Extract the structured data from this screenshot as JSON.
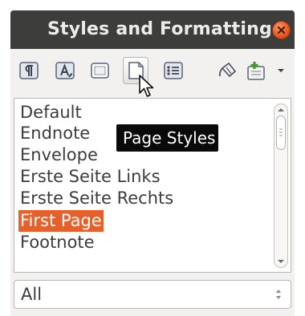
{
  "window": {
    "title": "Styles and Formatting",
    "close_icon": "close-icon"
  },
  "toolbar": {
    "buttons": [
      {
        "name": "paragraph-styles-icon"
      },
      {
        "name": "character-styles-icon"
      },
      {
        "name": "frame-styles-icon"
      },
      {
        "name": "page-styles-icon",
        "active": true
      },
      {
        "name": "list-styles-icon"
      },
      {
        "name": "fill-format-mode-icon"
      },
      {
        "name": "new-style-from-selection-icon"
      },
      {
        "name": "dropdown-arrow-icon"
      }
    ]
  },
  "tooltip": {
    "text": "Page Styles"
  },
  "style_list": {
    "items": [
      {
        "label": "Default"
      },
      {
        "label": "Endnote"
      },
      {
        "label": "Envelope"
      },
      {
        "label": "Erste Seite Links"
      },
      {
        "label": "Erste Seite Rechts"
      },
      {
        "label": "First Page",
        "selected": true
      },
      {
        "label": "Footnote"
      }
    ]
  },
  "filter": {
    "value": "All"
  },
  "colors": {
    "titlebar": "#3d3d3b",
    "selection": "#e6602b",
    "close": "#e9551f"
  }
}
